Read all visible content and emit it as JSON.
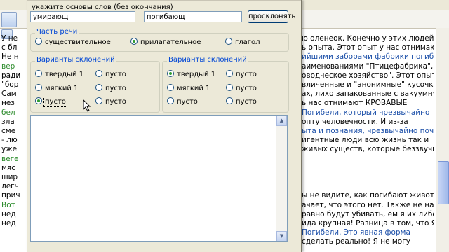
{
  "dialog": {
    "base_prompt": "укажите основы слов (без окончания)",
    "input1_value": "умирающ",
    "input2_value": "погибающ",
    "decline_button": "просклонять",
    "pos_group_title": "Часть речи",
    "pos_options": [
      {
        "label": "существительное",
        "selected": false
      },
      {
        "label": "прилагательное",
        "selected": true
      },
      {
        "label": "глагол",
        "selected": false
      }
    ],
    "decl_left": {
      "title": "Варианты склонений",
      "options": [
        {
          "label": "твердый 1",
          "selected": false
        },
        {
          "label": "пусто",
          "selected": false
        },
        {
          "label": "мягкий 1",
          "selected": false
        },
        {
          "label": "пусто",
          "selected": false
        },
        {
          "label": "пусто",
          "selected": true
        },
        {
          "label": "пусто",
          "selected": false
        }
      ]
    },
    "decl_right": {
      "title": "Варианты склонений",
      "options": [
        {
          "label": "твердый 1",
          "selected": true
        },
        {
          "label": "пусто",
          "selected": false
        },
        {
          "label": "мягкий 1",
          "selected": false
        },
        {
          "label": "пусто",
          "selected": false
        },
        {
          "label": "пусто",
          "selected": false
        },
        {
          "label": "пусто",
          "selected": false
        }
      ]
    }
  },
  "background": {
    "left_lines": [
      "У не",
      "с бл",
      "Не н",
      "вер",
      "ради",
      "\"бор",
      "Сам",
      "нез",
      "бел",
      "зла",
      "сме",
      "- лю",
      "уже",
      "веге",
      "мяс",
      "шир",
      "легч",
      "прич",
      "Вот ",
      "нед",
      "нед"
    ],
    "right_lines": [
      {
        "text": "ю оленеок. Конечно у этих людей",
        "cls": ""
      },
      {
        "text": "ь опыта. Этот опыт у нас отнимают",
        "cls": ""
      },
      {
        "text": "ийшими заборами фабрики погибели",
        "cls": "hl"
      },
      {
        "text": "аименованиями \"Птицефабрика\",",
        "cls": ""
      },
      {
        "text": "оводческое хозяйство\". Этот опыт",
        "cls": ""
      },
      {
        "text": "вличенные и \"анонимные\" кусочки",
        "cls": ""
      },
      {
        "text": "ах, лихо запакованные с вакуумную",
        "cls": ""
      },
      {
        "text": "ь нас отнимают КРОВАВЫЕ",
        "cls": ""
      },
      {
        "text": "Погибели, который чрезвычайно",
        "cls": "hl"
      },
      {
        "text": "опту человечности. И из-за",
        "cls": ""
      },
      {
        "text": "ыта и познания, чрезвычайно почти",
        "cls": "hl"
      },
      {
        "text": "игентные люди всю жизнь так и",
        "cls": ""
      },
      {
        "text": "живых существ, которые беззвучно",
        "cls": ""
      },
      {
        "text": "",
        "cls": ""
      },
      {
        "text": "",
        "cls": ""
      },
      {
        "text": "",
        "cls": ""
      },
      {
        "text": "",
        "cls": ""
      },
      {
        "text": "ы не видите, как погибают животные",
        "cls": ""
      },
      {
        "text": "ачает, что этого нет. Также не надо",
        "cls": ""
      },
      {
        "text": "равно будут убивать, ем я их либо",
        "cls": ""
      },
      {
        "text": "ида крупная! Разница в том, что Я НЕ",
        "cls": ""
      },
      {
        "text": "Погибели. Это явная форма",
        "cls": "hl"
      },
      {
        "text": "сделать реально! Я не могу",
        "cls": ""
      }
    ]
  },
  "colors": {
    "accent": "#0046d5",
    "dialog_bg": "#ece9d8",
    "radio_dot": "#2f9b2f"
  }
}
